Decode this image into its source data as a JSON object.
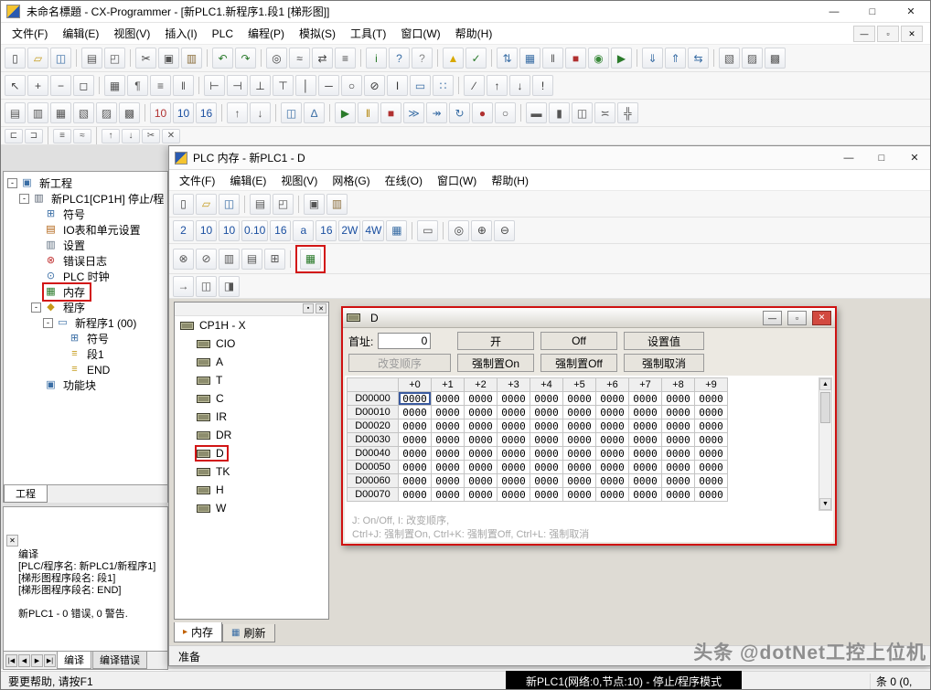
{
  "window": {
    "title": "未命名標題 - CX-Programmer - [新PLC1.新程序1.段1 [梯形图]]",
    "controls": {
      "minimize": "—",
      "maximize": "□",
      "close": "✕"
    }
  },
  "menubar": {
    "items": [
      "文件(F)",
      "编辑(E)",
      "视图(V)",
      "插入(I)",
      "PLC",
      "编程(P)",
      "模拟(S)",
      "工具(T)",
      "窗口(W)",
      "帮助(H)"
    ],
    "mdi_controls": {
      "minimize": "—",
      "restore": "▫",
      "close": "✕"
    }
  },
  "toolbars": {
    "row1": [
      [
        "new-file-button",
        "▯",
        "#444"
      ],
      [
        "open-file-button",
        "▱",
        "#c59a1a"
      ],
      [
        "save-button",
        "◫",
        "#3a6ea5"
      ],
      "|",
      [
        "print-button",
        "▤",
        "#555"
      ],
      [
        "print-preview-button",
        "◰",
        "#555"
      ],
      "|",
      [
        "cut-button",
        "✂",
        "#444"
      ],
      [
        "copy-button",
        "▣",
        "#555"
      ],
      [
        "paste-button",
        "▥",
        "#8a6d3b"
      ],
      "|",
      [
        "undo-button",
        "↶",
        "#2a7a2a"
      ],
      [
        "redo-button",
        "↷",
        "#2a7a2a"
      ],
      "|",
      [
        "find-button",
        "◎",
        "#444"
      ],
      [
        "find-next-button",
        "≈",
        "#444"
      ],
      [
        "replace-button",
        "⇄",
        "#444"
      ],
      [
        "search-all-button",
        "≡",
        "#444"
      ],
      "|",
      [
        "info-button",
        "i",
        "#2a7a2a"
      ],
      [
        "help-button",
        "?",
        "#3a6ea5"
      ],
      [
        "context-help-button",
        "?",
        "#888"
      ],
      "|",
      [
        "program-check-button",
        "▲",
        "#d8a800"
      ],
      [
        "compile-button",
        "✓",
        "#2a7a2a"
      ],
      "|",
      [
        "work-online-button",
        "⇅",
        "#3a6ea5"
      ],
      [
        "monitor-button",
        "▦",
        "#3a6ea5"
      ],
      [
        "pause-button",
        "‖",
        "#555"
      ],
      [
        "program-mode-button",
        "■",
        "#b03030"
      ],
      [
        "monitor-mode-button",
        "◉",
        "#3a8a3a"
      ],
      [
        "run-mode-button",
        "▶",
        "#2a7a2a"
      ],
      "|",
      [
        "download-button",
        "⇓",
        "#3a6ea5"
      ],
      [
        "upload-button",
        "⇑",
        "#3a6ea5"
      ],
      [
        "compare-button",
        "⇆",
        "#3a6ea5"
      ],
      "|",
      [
        "cascade-windows-button",
        "▧",
        "#555"
      ],
      [
        "tile-windows-button",
        "▨",
        "#555"
      ],
      [
        "watch-window-button",
        "▩",
        "#555"
      ]
    ],
    "row2": [
      [
        "pointer-tool-button",
        "↖",
        "#444"
      ],
      [
        "zoom-in-button",
        "+",
        "#444"
      ],
      [
        "zoom-out-button",
        "−",
        "#444"
      ],
      [
        "zoom-fit-button",
        "◻",
        "#444"
      ],
      "|",
      [
        "grid-toggle-button",
        "▦",
        "#555"
      ],
      [
        "show-comment-button",
        "¶",
        "#555"
      ],
      [
        "show-rung-numbers-button",
        "≡",
        "#555"
      ],
      [
        "show-wires-button",
        "‖",
        "#555"
      ],
      "|",
      [
        "contact-no-button",
        "⊢",
        "#333"
      ],
      [
        "contact-nc-button",
        "⊣",
        "#333"
      ],
      [
        "or-contact-no-button",
        "⊥",
        "#333"
      ],
      [
        "or-contact-nc-button",
        "⊤",
        "#333"
      ],
      [
        "vertical-line-button",
        "│",
        "#333"
      ],
      [
        "horizontal-line-button",
        "─",
        "#333"
      ],
      [
        "coil-button",
        "○",
        "#333"
      ],
      [
        "coil-nc-button",
        "⊘",
        "#333"
      ],
      [
        "instruction-button",
        "I",
        "#333"
      ],
      [
        "function-block-button",
        "▭",
        "#3a6ea5"
      ],
      [
        "fb-parameter-button",
        "∷",
        "#3a6ea5"
      ],
      "|",
      [
        "invert-button",
        "∕",
        "#333"
      ],
      [
        "differential-up-button",
        "↑",
        "#333"
      ],
      [
        "differential-down-button",
        "↓",
        "#333"
      ],
      [
        "immediate-refresh-button",
        "!",
        "#333"
      ]
    ],
    "row3": [
      [
        "toggle-project-tree-button",
        "▤",
        "#555"
      ],
      [
        "toggle-output-button",
        "▥",
        "#555"
      ],
      [
        "toggle-watch-button",
        "▦",
        "#555"
      ],
      [
        "toggle-cross-reference-button",
        "▧",
        "#555"
      ],
      [
        "toggle-address-reference-button",
        "▨",
        "#555"
      ],
      [
        "toggle-io-comment-button",
        "▩",
        "#555"
      ],
      "|",
      [
        "monitor-decimal-button",
        "10",
        "#b03030"
      ],
      [
        "monitor-signed-button",
        "10",
        "#1a4fa0"
      ],
      [
        "monitor-hex-button",
        "16",
        "#1a4fa0"
      ],
      "|",
      [
        "stack-up-button",
        "↑",
        "#555"
      ],
      [
        "stack-down-button",
        "↓",
        "#555"
      ],
      "|",
      [
        "watch-monitor-button",
        "◫",
        "#3a6ea5"
      ],
      [
        "differential-monitor-button",
        "∆",
        "#3a6ea5"
      ],
      "|",
      [
        "run-button",
        "▶",
        "#2a7a2a"
      ],
      [
        "pause-monitor-button",
        "‖",
        "#b08000"
      ],
      [
        "stop-button",
        "■",
        "#b03030"
      ],
      [
        "step-in-button",
        "≫",
        "#3a6ea5"
      ],
      [
        "step-over-button",
        "↠",
        "#3a6ea5"
      ],
      [
        "continuous-run-button",
        "↻",
        "#3a6ea5"
      ],
      [
        "set-breakpoint-button",
        "●",
        "#b03030"
      ],
      [
        "clear-breakpoint-button",
        "○",
        "#555"
      ],
      "|",
      [
        "tile-horizontal-button",
        "▬",
        "#555"
      ],
      [
        "tile-vertical-button",
        "▮",
        "#555"
      ],
      [
        "cascade-button",
        "◫",
        "#555"
      ],
      [
        "arrange-icons-button",
        "≍",
        "#555"
      ],
      [
        "cross-window-button",
        "╬",
        "#555"
      ]
    ],
    "row4": [
      [
        "interlock-button",
        "⊏",
        "#555"
      ],
      [
        "interlock-clear-button",
        "⊐",
        "#555"
      ],
      "|",
      [
        "rung-list-button",
        "≡",
        "#555"
      ],
      [
        "wrap-button",
        "≈",
        "#555"
      ],
      "|",
      [
        "move-up-button",
        "↑",
        "#555"
      ],
      [
        "move-down-button",
        "↓",
        "#555"
      ],
      [
        "cut-rung-button",
        "✂",
        "#555"
      ],
      [
        "close-toolbar-button",
        "✕",
        "#555"
      ]
    ]
  },
  "project_tree": {
    "items": [
      {
        "name": "project-root",
        "label": "新工程",
        "glyph": "▣",
        "color": "#3a6ea5",
        "indent": 0,
        "exp": true
      },
      {
        "name": "plc-node",
        "label": "新PLC1[CP1H] 停止/程",
        "glyph": "▥",
        "color": "#556070",
        "indent": 1,
        "exp": true
      },
      {
        "name": "symbols",
        "label": "符号",
        "glyph": "⊞",
        "color": "#3a6ea5",
        "indent": 2
      },
      {
        "name": "io-table",
        "label": "IO表和单元设置",
        "glyph": "▤",
        "color": "#b06010",
        "indent": 2
      },
      {
        "name": "settings",
        "label": "设置",
        "glyph": "▥",
        "color": "#607080",
        "indent": 2
      },
      {
        "name": "error-log",
        "label": "错误日志",
        "glyph": "⊗",
        "color": "#c03030",
        "indent": 2
      },
      {
        "name": "plc-clock",
        "label": "PLC 时钟",
        "glyph": "⊙",
        "color": "#3a6ea5",
        "indent": 2
      },
      {
        "name": "memory",
        "label": "内存",
        "glyph": "▦",
        "color": "#2a7a2a",
        "indent": 2,
        "hl": true
      },
      {
        "name": "program",
        "label": "程序",
        "glyph": "◆",
        "color": "#c59a1a",
        "indent": 2,
        "exp": true
      },
      {
        "name": "program-1",
        "label": "新程序1 (00)",
        "glyph": "▭",
        "color": "#3a6ea5",
        "indent": 3,
        "exp": true
      },
      {
        "name": "program-symbols",
        "label": "符号",
        "glyph": "⊞",
        "color": "#3a6ea5",
        "indent": 4
      },
      {
        "name": "section-1",
        "label": "段1",
        "glyph": "≡",
        "color": "#c59a1a",
        "indent": 4
      },
      {
        "name": "section-end",
        "label": "END",
        "glyph": "≡",
        "color": "#c59a1a",
        "indent": 4
      },
      {
        "name": "function-blocks",
        "label": "功能块",
        "glyph": "▣",
        "color": "#3a6ea5",
        "indent": 2
      }
    ],
    "tab": "工程"
  },
  "output_panel": {
    "close_glyph": "✕",
    "lines": [
      "编译",
      "[PLC/程序名: 新PLC1/新程序1]",
      "[梯形图程序段名: 段1]",
      "[梯形图程序段名: END]",
      "",
      "新PLC1 - 0 错误, 0 警告."
    ],
    "nav": [
      "|◀",
      "◀",
      "▶",
      "▶|"
    ],
    "tabs": [
      "编译",
      "编译错误"
    ]
  },
  "memory_window": {
    "title": "PLC 内存 - 新PLC1 - D",
    "controls": {
      "minimize": "—",
      "maximize": "□",
      "close": "✕"
    },
    "menus": [
      "文件(F)",
      "编辑(E)",
      "视图(V)",
      "网格(G)",
      "在线(O)",
      "窗口(W)",
      "帮助(H)"
    ],
    "toolbar1": [
      [
        "new-view-button",
        "▯",
        "#444"
      ],
      [
        "open-button",
        "▱",
        "#c59a1a"
      ],
      [
        "save-button",
        "◫",
        "#3a6ea5"
      ],
      "|",
      [
        "print-button",
        "▤",
        "#555"
      ],
      [
        "print-preview-button",
        "◰",
        "#555"
      ],
      "|",
      [
        "copy-button",
        "▣",
        "#555"
      ],
      [
        "paste-button",
        "▥",
        "#8a6d3b"
      ]
    ],
    "toolbar2": [
      [
        "format-binary-button",
        "2",
        "#1a4fa0"
      ],
      [
        "format-decimal-button",
        "10",
        "#1a4fa0"
      ],
      [
        "format-signed-button",
        "10",
        "#1a4fa0"
      ],
      [
        "format-float-button",
        "0.10",
        "#1a4fa0"
      ],
      [
        "format-hex-button",
        "16",
        "#1a4fa0"
      ],
      [
        "format-text-button",
        "a",
        "#1a4fa0"
      ],
      [
        "format-word-button",
        "16",
        "#1a4fa0"
      ],
      [
        "format-2w-button",
        "2W",
        "#1a4fa0"
      ],
      [
        "format-4w-button",
        "4W",
        "#1a4fa0"
      ],
      [
        "format-grid-button",
        "▦",
        "#3a6ea5"
      ],
      "|",
      [
        "io-comment-button",
        "▭",
        "#555"
      ],
      "|",
      [
        "zoom-100-button",
        "◎",
        "#444"
      ],
      [
        "zoom-in-button",
        "⊕",
        "#444"
      ],
      [
        "zoom-out-button",
        "⊖",
        "#444"
      ]
    ],
    "toolbar3": [
      [
        "force-on-button",
        "⊗",
        "#555"
      ],
      [
        "force-off-button",
        "⊘",
        "#555"
      ],
      [
        "force-cancel-button",
        "▥",
        "#555"
      ],
      [
        "set-value-button",
        "▤",
        "#555"
      ],
      [
        "transfer-to-plc-button",
        "⊞",
        "#555"
      ],
      "|",
      [
        "monitor-button",
        "▦",
        "#2a7a2a",
        "box"
      ]
    ],
    "toolbar4": [
      [
        "force-release-button",
        "→",
        "#555"
      ],
      [
        "pane-zoom-button",
        "◫",
        "#555"
      ],
      [
        "pane-zoom2-button",
        "◨",
        "#555"
      ]
    ],
    "tree": {
      "root": "CP1H - X",
      "header_buttons": [
        [
          "pin-icon",
          "▪"
        ],
        [
          "close-icon",
          "✕"
        ]
      ],
      "items": [
        [
          "mem-area-cio",
          "CIO"
        ],
        [
          "mem-area-a",
          "A"
        ],
        [
          "mem-area-t",
          "T"
        ],
        [
          "mem-area-c",
          "C"
        ],
        [
          "mem-area-ir",
          "IR"
        ],
        [
          "mem-area-dr",
          "DR"
        ],
        [
          "mem-area-d",
          "D",
          "hl"
        ],
        [
          "mem-area-tk",
          "TK"
        ],
        [
          "mem-area-h",
          "H"
        ],
        [
          "mem-area-w",
          "W"
        ]
      ]
    },
    "tabs": [
      [
        "tab-memory",
        "内存",
        "▸",
        "#c06000"
      ],
      [
        "tab-refresh",
        "刷新",
        "▦",
        "#3a6ea5"
      ]
    ],
    "status": "准备",
    "d_window": {
      "title": "D",
      "controls": {
        "minimize": "—",
        "restore": "▫",
        "close": "✕"
      },
      "first_address_label": "首址:",
      "first_address_value": "0",
      "buttons_row1": [
        [
          "on-button",
          "开"
        ],
        [
          "off-button",
          "Off"
        ],
        [
          "set-value-button",
          "设置值"
        ]
      ],
      "buttons_row2": [
        [
          "change-order-button",
          "改变顺序",
          "disabled"
        ],
        [
          "force-set-on-button",
          "强制置On"
        ],
        [
          "force-set-off-button",
          "强制置Off"
        ],
        [
          "force-cancel-button",
          "强制取消"
        ]
      ],
      "grid": {
        "columns": [
          "+0",
          "+1",
          "+2",
          "+3",
          "+4",
          "+5",
          "+6",
          "+7",
          "+8",
          "+9"
        ],
        "rows": [
          {
            "label": "D00000",
            "values": [
              "0000",
              "0000",
              "0000",
              "0000",
              "0000",
              "0000",
              "0000",
              "0000",
              "0000",
              "0000"
            ]
          },
          {
            "label": "D00010",
            "values": [
              "0000",
              "0000",
              "0000",
              "0000",
              "0000",
              "0000",
              "0000",
              "0000",
              "0000",
              "0000"
            ]
          },
          {
            "label": "D00020",
            "values": [
              "0000",
              "0000",
              "0000",
              "0000",
              "0000",
              "0000",
              "0000",
              "0000",
              "0000",
              "0000"
            ]
          },
          {
            "label": "D00030",
            "values": [
              "0000",
              "0000",
              "0000",
              "0000",
              "0000",
              "0000",
              "0000",
              "0000",
              "0000",
              "0000"
            ]
          },
          {
            "label": "D00040",
            "values": [
              "0000",
              "0000",
              "0000",
              "0000",
              "0000",
              "0000",
              "0000",
              "0000",
              "0000",
              "0000"
            ]
          },
          {
            "label": "D00050",
            "values": [
              "0000",
              "0000",
              "0000",
              "0000",
              "0000",
              "0000",
              "0000",
              "0000",
              "0000",
              "0000"
            ]
          },
          {
            "label": "D00060",
            "values": [
              "0000",
              "0000",
              "0000",
              "0000",
              "0000",
              "0000",
              "0000",
              "0000",
              "0000",
              "0000"
            ]
          },
          {
            "label": "D00070",
            "values": [
              "0000",
              "0000",
              "0000",
              "0000",
              "0000",
              "0000",
              "0000",
              "0000",
              "0000",
              "0000"
            ]
          }
        ]
      },
      "hint_line1": "J: On/Off,  I: 改变顺序,",
      "hint_line2": "Ctrl+J: 强制置On, Ctrl+K: 强制置Off, Ctrl+L: 强制取消",
      "scrollbar": {
        "up": "▲",
        "down": "▼"
      }
    }
  },
  "statusbar": {
    "help": "要更帮助, 请按F1",
    "plc_status": "新PLC1(网络:0,节点:10) - 停止/程序模式",
    "right": "条 0 (0,"
  },
  "watermark": "头条 @dotNet工控上位机"
}
